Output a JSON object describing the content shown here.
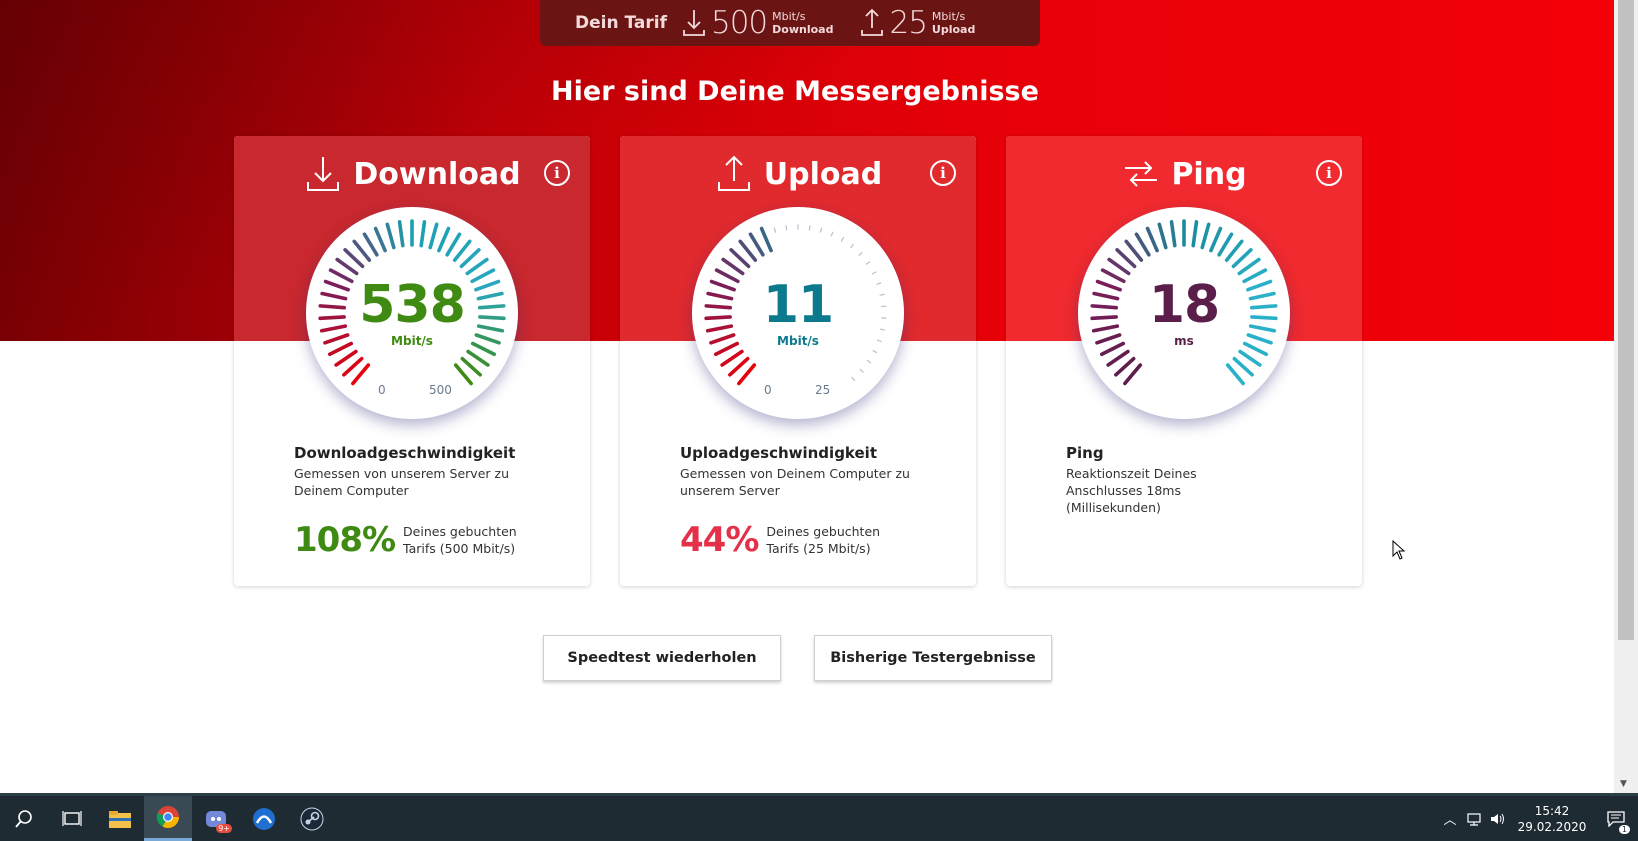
{
  "tarif": {
    "label": "Dein Tarif",
    "download_value": "500",
    "download_unit": "Mbit/s",
    "download_label": "Download",
    "upload_value": "25",
    "upload_unit": "Mbit/s",
    "upload_label": "Upload"
  },
  "headline": "Hier sind Deine Messergebnisse",
  "cards": {
    "download": {
      "title": "Download",
      "value": "538",
      "unit": "Mbit/s",
      "scale_min": "0",
      "scale_max": "500",
      "desc_title": "Downloadgeschwindigkeit",
      "desc_text": "Gemessen von unserem Server zu Deinem Computer",
      "percent": "108%",
      "percent_text": "Deines gebuchten Tarifs (500 Mbit/s)",
      "value_color": "#3e8a12",
      "percent_color": "#3e8a12",
      "gauge_fill": 1.0
    },
    "upload": {
      "title": "Upload",
      "value": "11",
      "unit": "Mbit/s",
      "scale_min": "0",
      "scale_max": "25",
      "desc_title": "Uploadgeschwindigkeit",
      "desc_text": "Gemessen von Deinem Computer zu unserem Server",
      "percent": "44%",
      "percent_text": "Deines gebuchten Tarifs (25 Mbit/s)",
      "value_color": "#0c7a8c",
      "percent_color": "#e5304a",
      "gauge_fill": 0.44
    },
    "ping": {
      "title": "Ping",
      "value": "18",
      "unit": "ms",
      "desc_title": "Ping",
      "desc_text": "Reaktionszeit Deines Anschlusses 18ms (Millisekunden)",
      "value_color": "#5b1e4a",
      "gauge_fill": 1.0
    }
  },
  "buttons": {
    "repeat": "Speedtest wiederholen",
    "history": "Bisherige Testergebnisse"
  },
  "taskbar": {
    "time": "15:42",
    "date": "29.02.2020",
    "notification_count": "1",
    "discord_badge": "9+"
  },
  "colors": {
    "brand_red": "#e60008",
    "dark_red": "#7a0004",
    "tarif_bg": "#6b1414"
  }
}
